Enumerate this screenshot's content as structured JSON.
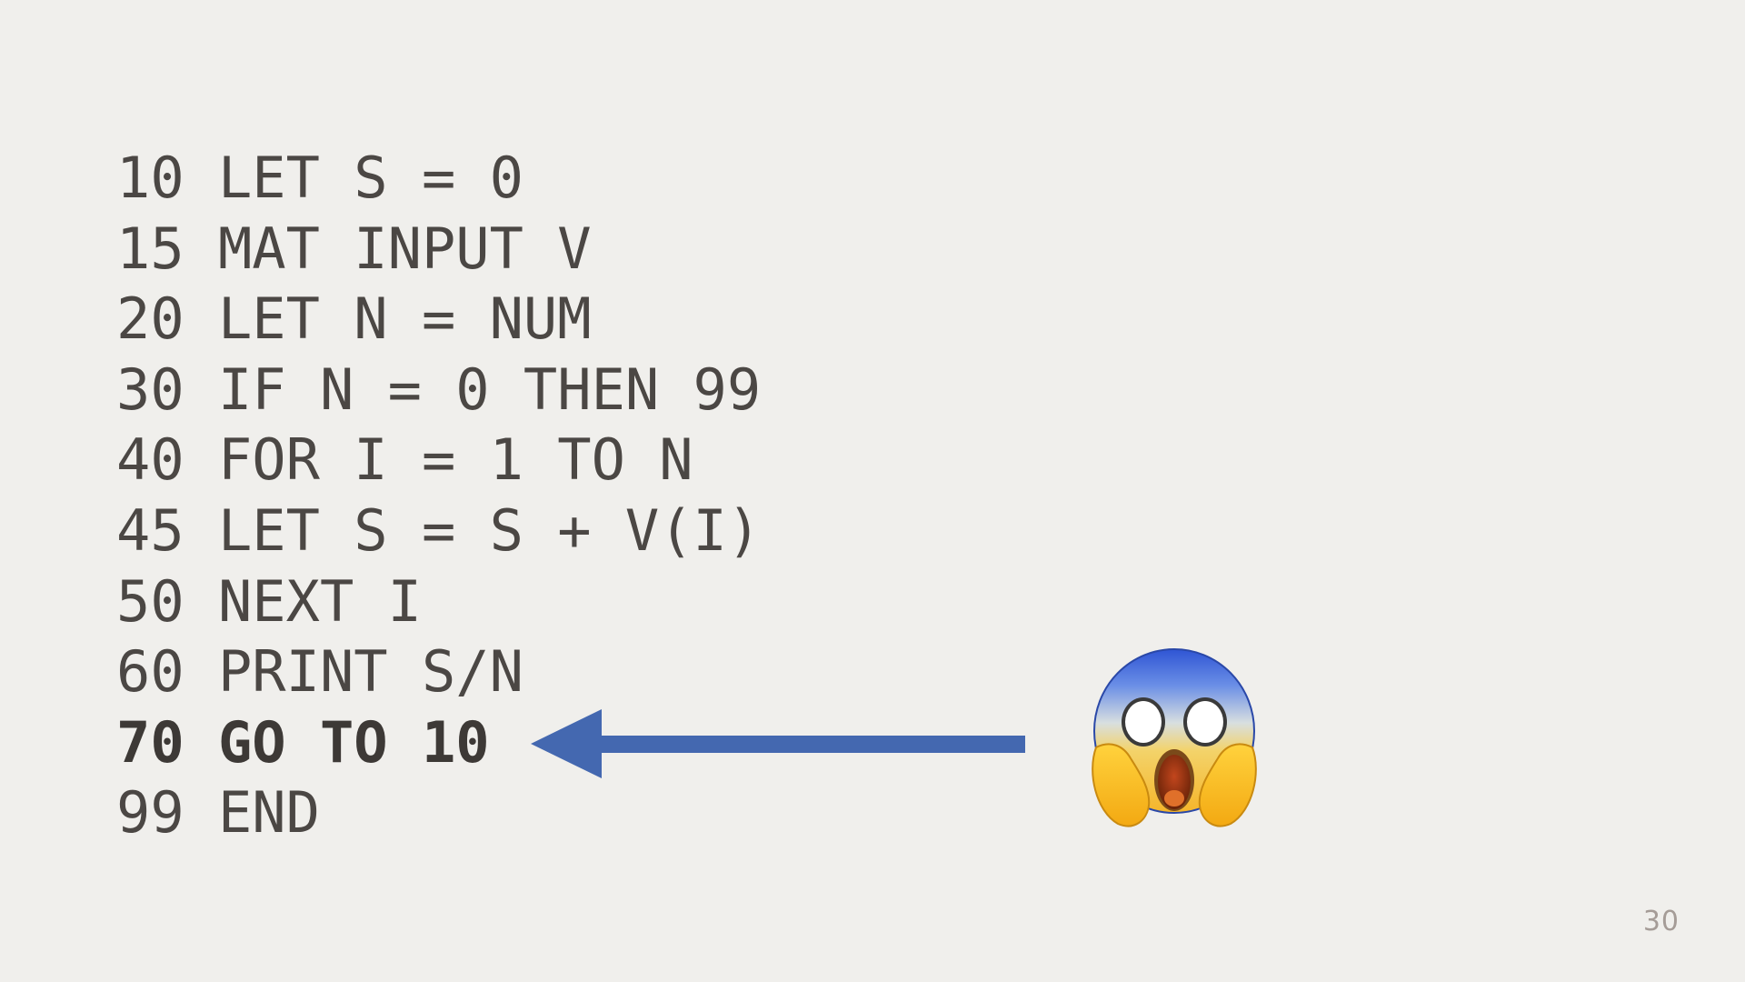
{
  "code": {
    "lines": [
      {
        "text": "10 LET S = 0",
        "highlighted": false
      },
      {
        "text": "15 MAT INPUT V",
        "highlighted": false
      },
      {
        "text": "20 LET N = NUM",
        "highlighted": false
      },
      {
        "text": "30 IF N = 0 THEN 99",
        "highlighted": false
      },
      {
        "text": "40 FOR I = 1 TO N",
        "highlighted": false
      },
      {
        "text": "45 LET S = S + V(I)",
        "highlighted": false
      },
      {
        "text": "50 NEXT I",
        "highlighted": false
      },
      {
        "text": "60 PRINT S/N",
        "highlighted": false
      },
      {
        "text": "70 GO TO 10",
        "highlighted": true
      },
      {
        "text": "99 END",
        "highlighted": false
      }
    ]
  },
  "annotation": {
    "arrow_color": "#4468b0",
    "emoji_icon": "face-screaming-in-fear-icon"
  },
  "footer": {
    "page_number": "30"
  },
  "colors": {
    "background": "#f0efec",
    "code_text": "#4b4744",
    "page_number": "#a59c97"
  }
}
